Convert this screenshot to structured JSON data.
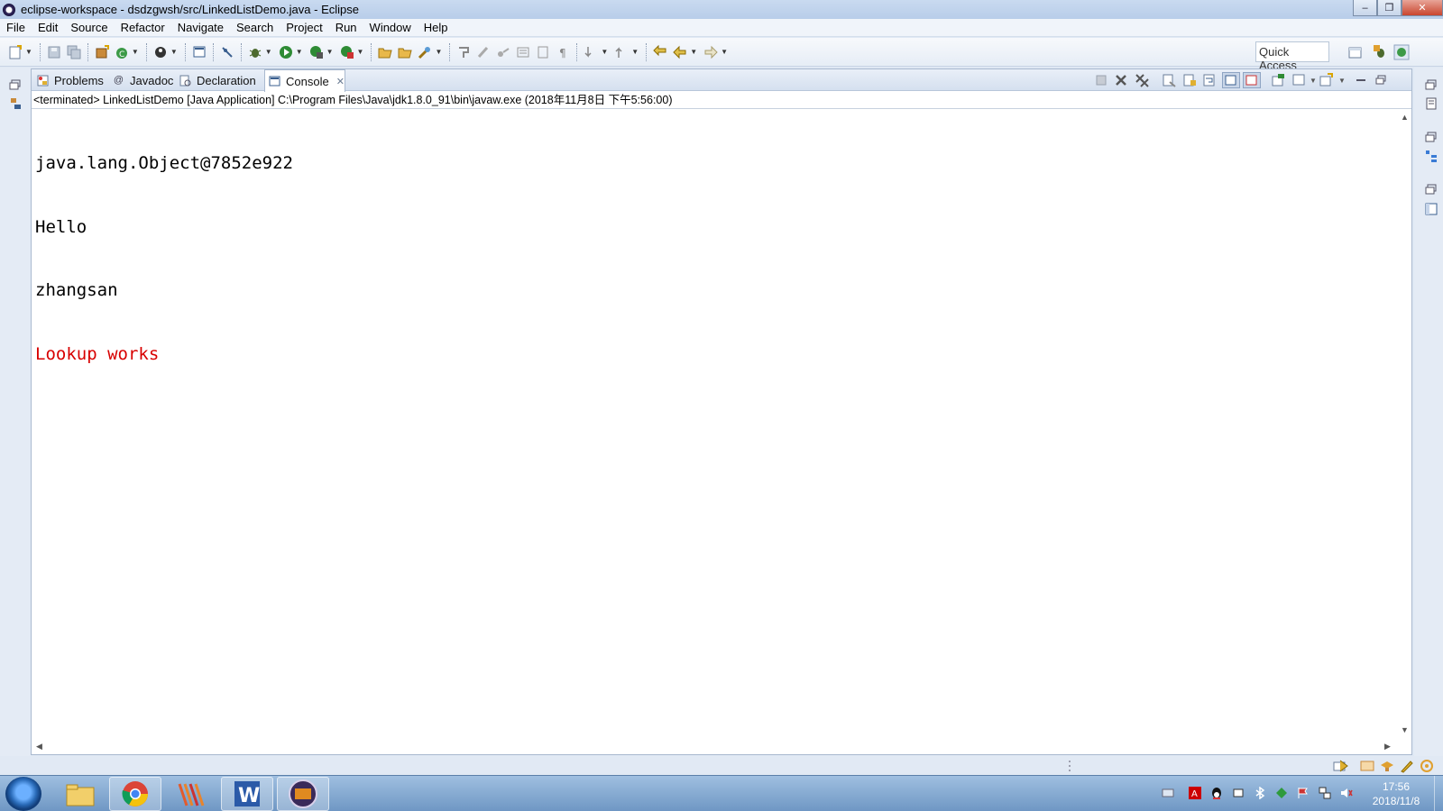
{
  "window": {
    "title": "eclipse-workspace - dsdzgwsh/src/LinkedListDemo.java - Eclipse"
  },
  "menu": [
    "File",
    "Edit",
    "Source",
    "Refactor",
    "Navigate",
    "Search",
    "Project",
    "Run",
    "Window",
    "Help"
  ],
  "toolbar": {
    "quick_access": "Quick Access"
  },
  "tabs": [
    {
      "label": "Problems",
      "icon": "problems-icon"
    },
    {
      "label": "Javadoc",
      "icon": "at-icon"
    },
    {
      "label": "Declaration",
      "icon": "declaration-icon"
    },
    {
      "label": "Console",
      "icon": "console-icon",
      "active": true
    }
  ],
  "console": {
    "description": "<terminated> LinkedListDemo [Java Application] C:\\Program Files\\Java\\jdk1.8.0_91\\bin\\javaw.exe (2018年11月8日 下午5:56:00)",
    "lines": [
      {
        "text": "java.lang.Object@7852e922",
        "stream": "stdout"
      },
      {
        "text": "Hello",
        "stream": "stdout"
      },
      {
        "text": "zhangsan",
        "stream": "stdout"
      },
      {
        "text": "Lookup works",
        "stream": "stderr"
      }
    ]
  },
  "colors": {
    "stderr": "#d80000",
    "accent": "#2c5aa0"
  },
  "taskbar": {
    "clock_time": "17:56",
    "clock_date": "2018/11/8"
  }
}
